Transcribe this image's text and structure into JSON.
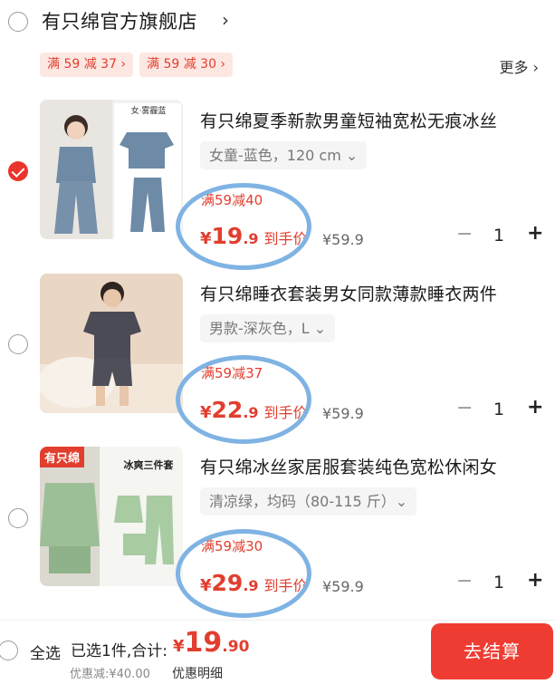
{
  "shop": {
    "name": "有只绵官方旗舰店",
    "arrow": "›",
    "coupons": [
      "满 59 减 37 ›",
      "满 59 减 30 ›"
    ],
    "more": "更多 ›"
  },
  "items": [
    {
      "title": "有只绵夏季新款男童短袖宽松无痕冰丝",
      "sku": "女童-蓝色，120 cm ⌄",
      "promo": "满59减40",
      "price_currency": "¥",
      "price_int": "19",
      "price_dec": ".9",
      "price_tag": "到手价",
      "orig_price": "¥59.9",
      "qty": "1",
      "checked": true,
      "thumb_label": "女·雾霾蓝"
    },
    {
      "title": "有只绵睡衣套装男女同款薄款睡衣两件",
      "sku": "男款-深灰色，L ⌄",
      "promo": "满59减37",
      "price_currency": "¥",
      "price_int": "22",
      "price_dec": ".9",
      "price_tag": "到手价",
      "orig_price": "¥59.9",
      "qty": "1",
      "checked": false
    },
    {
      "title": "有只绵冰丝家居服套装纯色宽松休闲女",
      "sku": "清凉绿，均码（80-115 斤）⌄",
      "promo": "满59减30",
      "price_currency": "¥",
      "price_int": "29",
      "price_dec": ".9",
      "price_tag": "到手价",
      "orig_price": "¥59.9",
      "qty": "1",
      "checked": false,
      "thumb_badge": "有只绵",
      "thumb_label": "冰爽三件套"
    }
  ],
  "controls": {
    "minus": "−",
    "plus": "+"
  },
  "footer": {
    "select_all": "全选",
    "summary": "已选1件,合计:",
    "total_currency": "¥",
    "total_int": "19",
    "total_dec": ".90",
    "discount": "优惠减:¥40.00",
    "detail": "优惠明细",
    "checkout": "去结算"
  },
  "colors": {
    "accent": "#e23e2e",
    "checkout_bg": "#ef3c32",
    "coupon_bg": "#fde7e2",
    "annotation_ring": "#7fb3e3"
  }
}
